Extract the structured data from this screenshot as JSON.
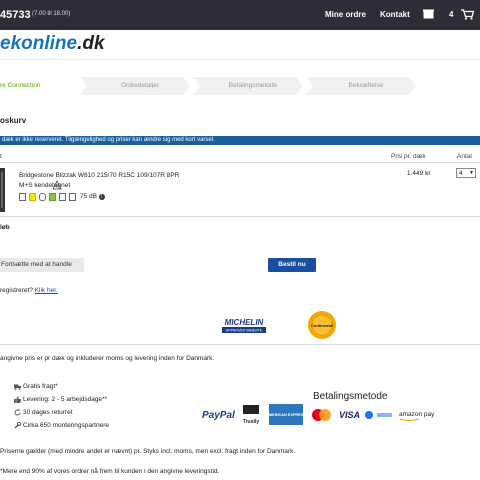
{
  "header": {
    "phone": "45733",
    "hours": "(7.00 til 18.00)",
    "nav_orders": "Mine ordre",
    "nav_contact": "Kontakt",
    "cart_count": "4"
  },
  "logo": {
    "main": "ekonline",
    "tld": ".dk"
  },
  "steps": [
    {
      "label": "re Connection",
      "active": true
    },
    {
      "label": "Ordredetaljer",
      "active": false
    },
    {
      "label": "Betalingsmetode",
      "active": false
    },
    {
      "label": "Bekræftelse",
      "active": false
    }
  ],
  "cart": {
    "title": "oskurv",
    "alert": "dæk er ikke reserveret. Tilgængelighed og priser kan ændre sig med kort varsel.",
    "col_product": "t",
    "col_price": "Pris pr. dæk",
    "col_qty": "Antal",
    "item": {
      "name": "Bridgestone Blizzak W810 215/70 R15C 109/107R 8PR",
      "ms": "M+S kendetegnet",
      "noise": "75 dB",
      "price": "1.449 kr",
      "qty": "4"
    },
    "total_label": "løb",
    "continue_label": "Fortsætte med at handle",
    "order_label": "Bestil nu",
    "register_text": "registreret?",
    "register_link": "Klik her."
  },
  "partners": {
    "michelin": "MICHELIN",
    "michelin_sub": "APPROVED WEBSITE",
    "conti": "Continental"
  },
  "info": {
    "price_info": "angivne pris er pr dæk og inkluderer moms og levering inden for Danmark.",
    "benefits": [
      {
        "icon": "truck-icon",
        "text": "Gratis fragt*"
      },
      {
        "icon": "thumbs-up-icon",
        "text": "Levering: 2 - 5 arbejdsdage**"
      },
      {
        "icon": "return-icon",
        "text": "30 dages returret"
      },
      {
        "icon": "wrench-icon",
        "text": "Cirka 650 monteringspartnere"
      }
    ],
    "payment_title": "Betalingsmetode",
    "footnote1": "Priserne gælder (med mindre andet er nævnt) pr. Styks incl. moms, men excl. fragt inden for Danmark.",
    "footnote2": "*Mere end 90% af vores ordrer nå frem til kunden i den angivne leveringstid."
  },
  "payment": {
    "paypal": "PayPal",
    "trustly": "Trustly",
    "amex": "AMERICAN EXPRESS",
    "visa": "VISA",
    "amazon": "amazon pay"
  },
  "colors": {
    "brand_blue": "#1a73b8",
    "topbar": "#2d2d35",
    "alert": "#1a5f9e",
    "order_btn": "#1a4fa0",
    "step_active": "#5aa300"
  }
}
